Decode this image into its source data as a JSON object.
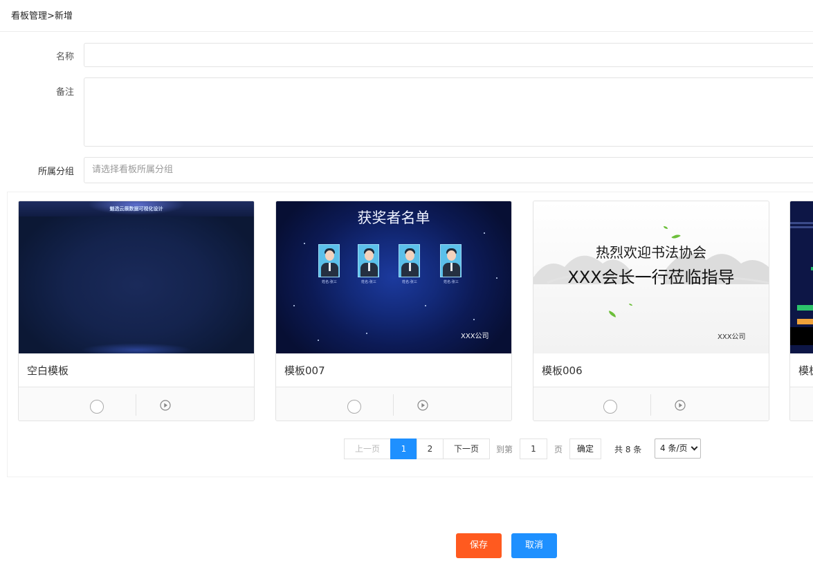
{
  "breadcrumb": {
    "text": "看板管理>新增"
  },
  "form": {
    "name_label": "名称",
    "name_value": "",
    "remark_label": "备注",
    "remark_value": "",
    "group_label": "所属分组",
    "group_placeholder": "请选择看板所属分组"
  },
  "templates": [
    {
      "title": "空白模板",
      "thumb_title": "魅选云展数据可视化设计"
    },
    {
      "title": "模板007",
      "thumb_title": "获奖者名单",
      "names": [
        "姓名:张三",
        "姓名:张三",
        "姓名:张三",
        "姓名:张三"
      ],
      "company": "XXX公司"
    },
    {
      "title": "模板006",
      "line1": "热烈欢迎书法协会",
      "line2": "XXX会长一行莅临指导",
      "company": "XXX公司"
    },
    {
      "title": "模板"
    }
  ],
  "pagination": {
    "prev": "上一页",
    "pages": [
      "1",
      "2"
    ],
    "current": "1",
    "next": "下一页",
    "goto_prefix": "到第",
    "goto_value": "1",
    "goto_suffix": "页",
    "confirm": "确定",
    "total": "共 8 条",
    "page_size": "4 条/页"
  },
  "actions": {
    "save": "保存",
    "cancel": "取消"
  },
  "colors": {
    "primary": "#1e90ff",
    "save": "#ff5a1f",
    "cancel": "#1e90ff"
  },
  "icons": [
    "radio-circle-icon",
    "play-circle-icon"
  ]
}
